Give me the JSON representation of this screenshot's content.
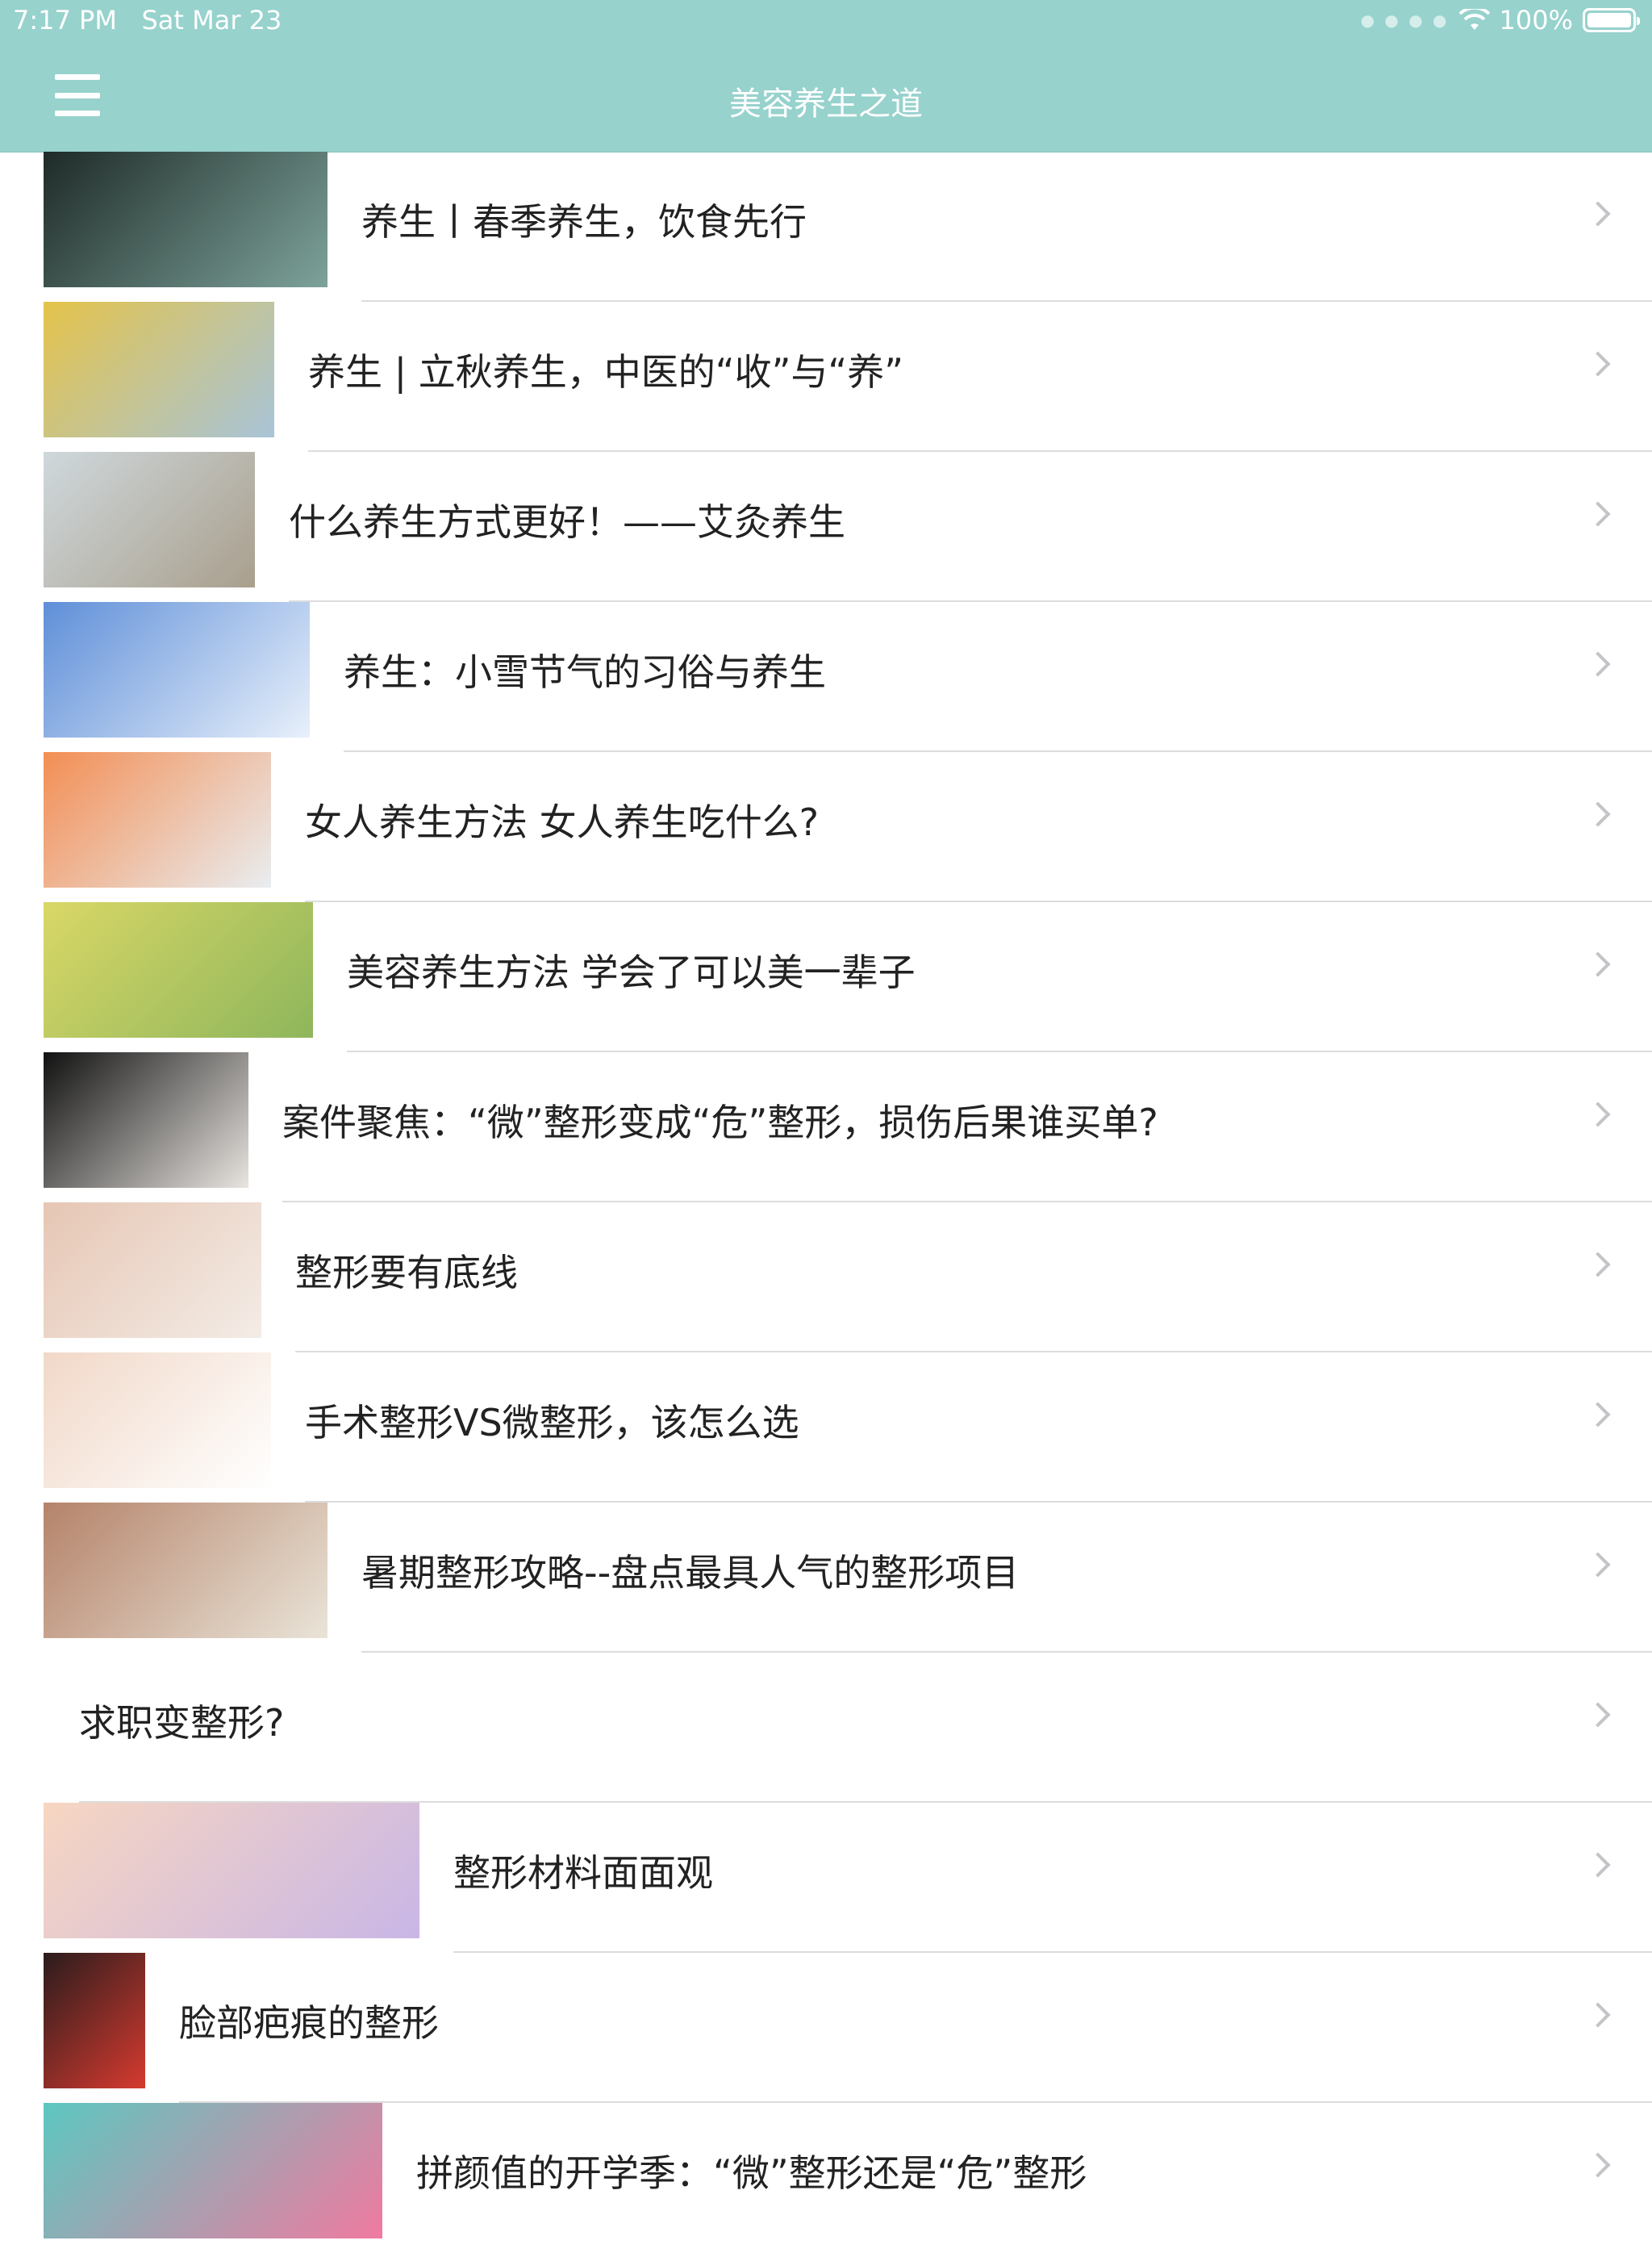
{
  "status_bar": {
    "time": "7:17 PM",
    "date": "Sat Mar 23",
    "battery": "100%",
    "wifi_icon": "wifi-icon"
  },
  "nav": {
    "title": "美容养生之道",
    "menu_icon": "hamburger-menu-icon"
  },
  "articles": [
    {
      "title": "养生丨春季养生，饮食先行",
      "thumb": "spring-teacup-photo",
      "colors": [
        "#1e2a28",
        "#7da39a"
      ]
    },
    {
      "title": "养生 | 立秋养生，中医的“收”与“养”",
      "thumb": "autumn-leaf-photo",
      "colors": [
        "#e4c34a",
        "#a8c4d8"
      ]
    },
    {
      "title": "什么养生方式更好！——艾灸养生",
      "thumb": "beach-meditation-photo",
      "colors": [
        "#cfd8dc",
        "#a99f8d"
      ]
    },
    {
      "title": "养生：小雪节气的习俗与养生",
      "thumb": "snow-branch-photo",
      "colors": [
        "#5f8fd8",
        "#e8f0fb"
      ]
    },
    {
      "title": "女人养生方法 女人养生吃什么?",
      "thumb": "salmon-sashimi-photo",
      "colors": [
        "#f38e54",
        "#e9edf0"
      ]
    },
    {
      "title": "美容养生方法 学会了可以美一辈子",
      "thumb": "lemon-drink-photo",
      "colors": [
        "#d9d766",
        "#8eb65c"
      ]
    },
    {
      "title": "案件聚焦：“微”整形变成“危”整形，损伤后果谁买单?",
      "thumb": "bandaged-face-photo",
      "colors": [
        "#111111",
        "#e8e4e0"
      ]
    },
    {
      "title": "整形要有底线",
      "thumb": "two-faces-photo",
      "colors": [
        "#e6c6b4",
        "#f3ece6"
      ]
    },
    {
      "title": "手术整形VS微整形，该怎么选",
      "thumb": "face-surgery-photo",
      "colors": [
        "#f1d8c8",
        "#ffffff"
      ]
    },
    {
      "title": "暑期整形攻略--盘点最具人气的整形项目",
      "thumb": "smiling-woman-photo",
      "colors": [
        "#b5836a",
        "#e9e4d8"
      ]
    },
    {
      "title": "求职变整形?",
      "thumb": "",
      "colors": []
    },
    {
      "title": "整形材料面面观",
      "thumb": "cartilage-diagram-image",
      "colors": [
        "#f7d6c1",
        "#c9b6e6"
      ]
    },
    {
      "title": "脸部疤痕的整形",
      "thumb": "red-lips-photo",
      "colors": [
        "#2a1c1c",
        "#d63a2f"
      ]
    },
    {
      "title": "拼颜值的开学季：“微”整形还是“危”整形",
      "thumb": "glasses-girl-banner",
      "colors": [
        "#5cc7c0",
        "#f07aa0"
      ]
    }
  ]
}
